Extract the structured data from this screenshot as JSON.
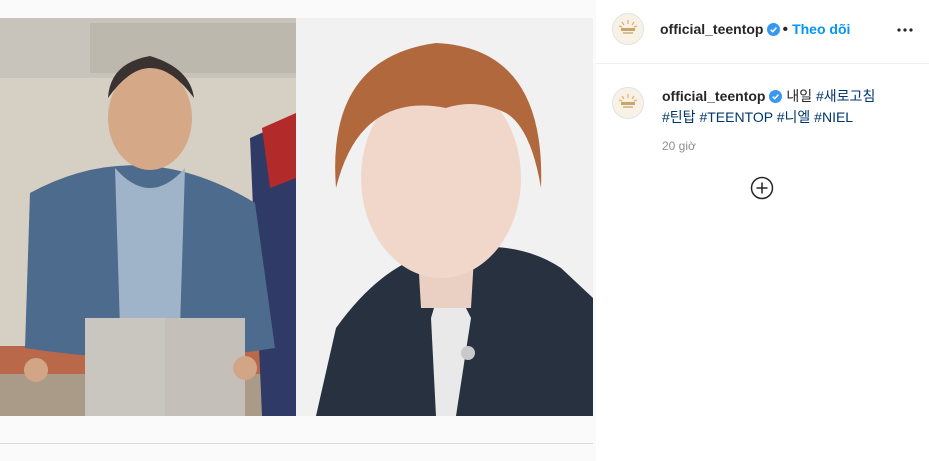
{
  "post": {
    "header": {
      "username": "official_teentop",
      "separator": "•",
      "follow_label": "Theo dõi",
      "more_icon": "more-horizontal-icon"
    },
    "caption": {
      "username": "official_teentop",
      "text": "내일",
      "hashtags": [
        "#새로고침",
        "#틴탑",
        "#TEENTOP",
        "#니엘",
        "#NIEL"
      ]
    },
    "timestamp": "20 giờ",
    "load_more_icon": "plus-circle-icon",
    "colors": {
      "accent": "#0095f6",
      "hashtag": "#00376b",
      "verified": "#3897f0",
      "muted": "#8e8e8e"
    }
  }
}
